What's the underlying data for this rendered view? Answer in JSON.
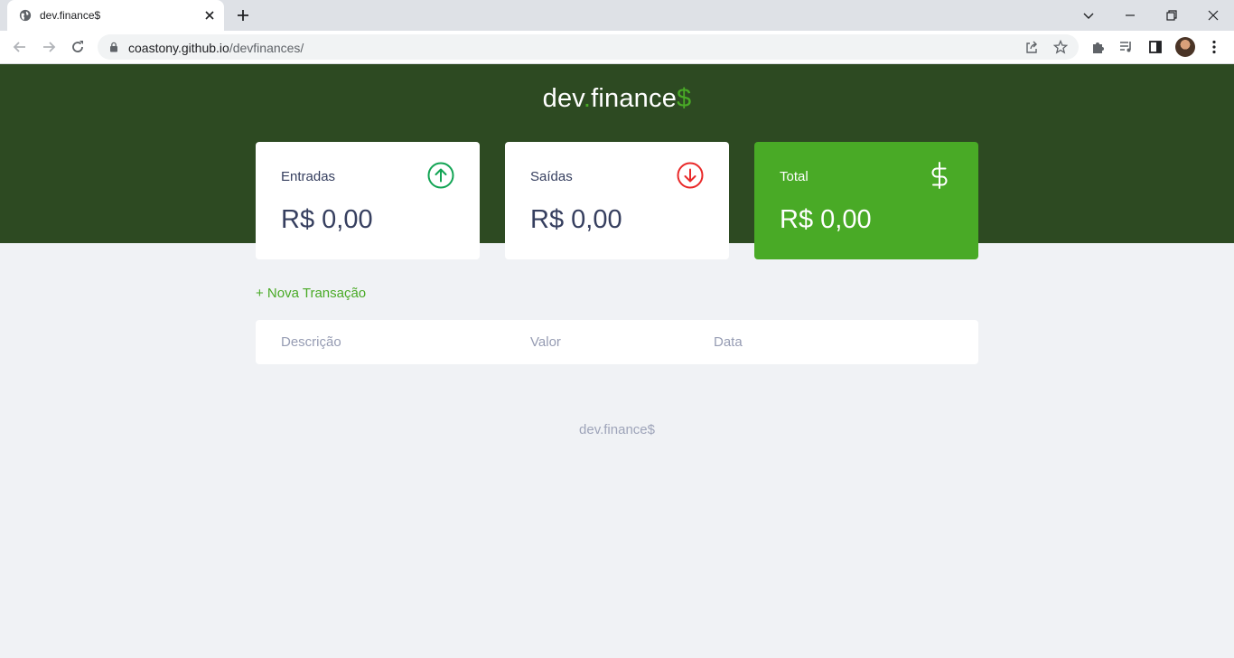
{
  "browser": {
    "tab_title": "dev.finance$",
    "url_host": "coastony.github.io",
    "url_path": "/devfinances/"
  },
  "logo": {
    "part1": "dev",
    "dot": ".",
    "part2": "finance",
    "dollar": "$"
  },
  "cards": {
    "income": {
      "label": "Entradas",
      "value": "R$ 0,00",
      "icon": "arrow-up-circle-icon",
      "color": "#12a454"
    },
    "expense": {
      "label": "Saídas",
      "value": "R$ 0,00",
      "icon": "arrow-down-circle-icon",
      "color": "#e92929"
    },
    "total": {
      "label": "Total",
      "value": "R$ 0,00",
      "icon": "dollar-sign-icon",
      "color": "#49aa26"
    }
  },
  "new_transaction_label": "+ Nova Transação",
  "table": {
    "headers": [
      "Descrição",
      "Valor",
      "Data"
    ]
  },
  "footer": "dev.finance$",
  "colors": {
    "header_bg": "#2d4a22",
    "accent": "#49aa26",
    "page_bg": "#f0f2f5",
    "text": "#363f5f",
    "muted": "#969cb3"
  }
}
